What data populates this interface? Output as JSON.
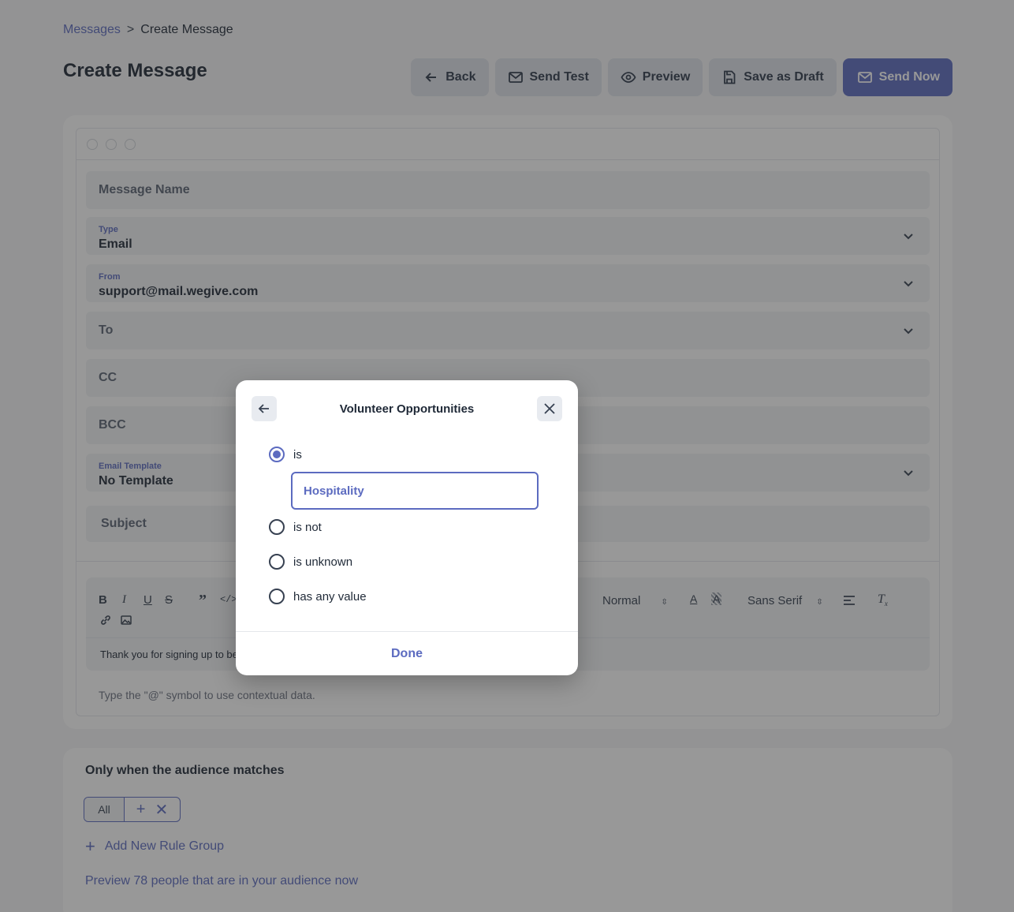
{
  "breadcrumb": {
    "parent": "Messages",
    "separator": ">",
    "current": "Create Message"
  },
  "page_title": "Create Message",
  "toolbar": {
    "back": "Back",
    "send_test": "Send Test",
    "preview": "Preview",
    "save_draft": "Save as Draft",
    "send_now": "Send Now"
  },
  "form": {
    "message_name_placeholder": "Message Name",
    "type": {
      "label": "Type",
      "value": "Email"
    },
    "from": {
      "label": "From",
      "value": "support@mail.wegive.com"
    },
    "to_placeholder": "To",
    "cc_placeholder": "CC",
    "bcc_placeholder": "BCC",
    "template": {
      "label": "Email Template",
      "value": "No Template"
    },
    "subject_placeholder": "Subject"
  },
  "editor": {
    "size_select": "Normal",
    "font_select": "Sans Serif",
    "body_text": "Thank you for signing up to be",
    "hint": "Type the \"@\" symbol to use contextual data."
  },
  "audience": {
    "title": "Only when the audience matches",
    "match_mode": "All",
    "add_group": "Add New Rule Group",
    "preview_link": "Preview 78 people that are in your audience now"
  },
  "modal": {
    "title": "Volunteer Opportunities",
    "options": [
      "is",
      "is not",
      "is unknown",
      "has any value"
    ],
    "selected": "is",
    "input_value": "Hospitality",
    "done": "Done"
  },
  "colors": {
    "accent": "#5c6bc0",
    "button_bg": "#dfe3ea",
    "field_bg": "#f1f3f6"
  }
}
